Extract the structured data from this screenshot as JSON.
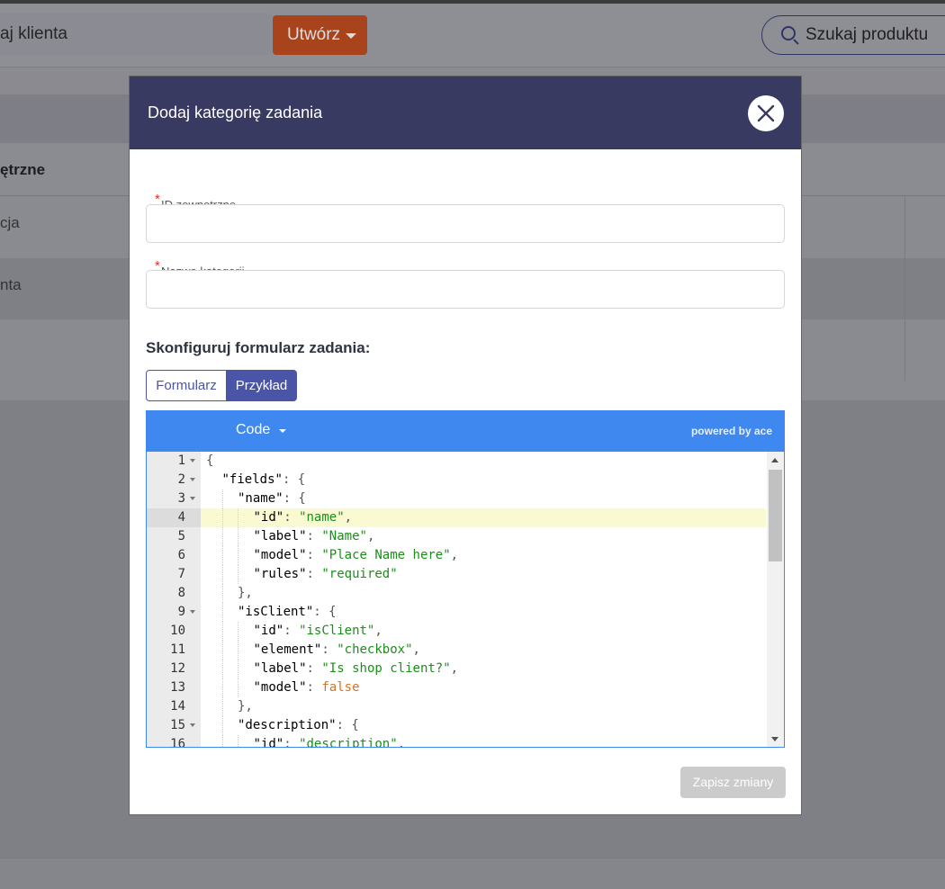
{
  "background": {
    "client_search_text": "aj klienta",
    "create_button_label": "Utwórz",
    "product_search_placeholder": "Szukaj produktu",
    "table_header_fragment": "ętrzne",
    "row_fragments": [
      "cja",
      "nta"
    ]
  },
  "modal": {
    "title": "Dodaj kategorię zadania",
    "fields": {
      "external_id": {
        "label": "ID zewnętrzne",
        "required_marker": "*",
        "value": ""
      },
      "category_name": {
        "label": "Nazwa kategorii",
        "required_marker": "*",
        "value": ""
      }
    },
    "section_title": "Skonfiguruj formularz zadania:",
    "toggle": {
      "form_label": "Formularz",
      "example_label": "Przykład",
      "active": "Przykład"
    },
    "editor": {
      "mode_label": "Code",
      "powered_by": "powered by ace",
      "active_line": 4,
      "lines": [
        {
          "n": "1",
          "fold": true,
          "indent": 0,
          "tokens": [
            [
              "punc",
              "{"
            ]
          ]
        },
        {
          "n": "2",
          "fold": true,
          "indent": 1,
          "tokens": [
            [
              "key",
              "\"fields\""
            ],
            [
              "punc",
              ": {"
            ]
          ]
        },
        {
          "n": "3",
          "fold": true,
          "indent": 2,
          "tokens": [
            [
              "key",
              "\"name\""
            ],
            [
              "punc",
              ": {"
            ]
          ]
        },
        {
          "n": "4",
          "fold": false,
          "indent": 3,
          "tokens": [
            [
              "key",
              "\"id\""
            ],
            [
              "punc",
              ": "
            ],
            [
              "str",
              "\"name\""
            ],
            [
              "punc",
              ","
            ]
          ]
        },
        {
          "n": "5",
          "fold": false,
          "indent": 3,
          "tokens": [
            [
              "key",
              "\"label\""
            ],
            [
              "punc",
              ": "
            ],
            [
              "str",
              "\"Name\""
            ],
            [
              "punc",
              ","
            ]
          ]
        },
        {
          "n": "6",
          "fold": false,
          "indent": 3,
          "tokens": [
            [
              "key",
              "\"model\""
            ],
            [
              "punc",
              ": "
            ],
            [
              "str",
              "\"Place Name here\""
            ],
            [
              "punc",
              ","
            ]
          ]
        },
        {
          "n": "7",
          "fold": false,
          "indent": 3,
          "tokens": [
            [
              "key",
              "\"rules\""
            ],
            [
              "punc",
              ": "
            ],
            [
              "str",
              "\"required\""
            ]
          ]
        },
        {
          "n": "8",
          "fold": false,
          "indent": 2,
          "tokens": [
            [
              "punc",
              "},"
            ]
          ]
        },
        {
          "n": "9",
          "fold": true,
          "indent": 2,
          "tokens": [
            [
              "key",
              "\"isClient\""
            ],
            [
              "punc",
              ": {"
            ]
          ]
        },
        {
          "n": "10",
          "fold": false,
          "indent": 3,
          "tokens": [
            [
              "key",
              "\"id\""
            ],
            [
              "punc",
              ": "
            ],
            [
              "str",
              "\"isClient\""
            ],
            [
              "punc",
              ","
            ]
          ]
        },
        {
          "n": "11",
          "fold": false,
          "indent": 3,
          "tokens": [
            [
              "key",
              "\"element\""
            ],
            [
              "punc",
              ": "
            ],
            [
              "str",
              "\"checkbox\""
            ],
            [
              "punc",
              ","
            ]
          ]
        },
        {
          "n": "12",
          "fold": false,
          "indent": 3,
          "tokens": [
            [
              "key",
              "\"label\""
            ],
            [
              "punc",
              ": "
            ],
            [
              "str",
              "\"Is shop client?\""
            ],
            [
              "punc",
              ","
            ]
          ]
        },
        {
          "n": "13",
          "fold": false,
          "indent": 3,
          "tokens": [
            [
              "key",
              "\"model\""
            ],
            [
              "punc",
              ": "
            ],
            [
              "kw",
              "false"
            ]
          ]
        },
        {
          "n": "14",
          "fold": false,
          "indent": 2,
          "tokens": [
            [
              "punc",
              "},"
            ]
          ]
        },
        {
          "n": "15",
          "fold": true,
          "indent": 2,
          "tokens": [
            [
              "key",
              "\"description\""
            ],
            [
              "punc",
              ": {"
            ]
          ]
        },
        {
          "n": "16",
          "fold": false,
          "indent": 3,
          "tokens": [
            [
              "key",
              "\"id\""
            ],
            [
              "punc",
              ": "
            ],
            [
              "str",
              "\"description\""
            ],
            [
              "punc",
              ","
            ]
          ]
        }
      ]
    },
    "save_button_label": "Zapisz zmiany"
  },
  "colors": {
    "header_bg": "#383a61",
    "accent": "#4b55a8",
    "editor_toolbar": "#3f88f0",
    "string_token": "#1a8f1a",
    "keyword_token": "#d8741c",
    "required_star": "#e0301e"
  }
}
